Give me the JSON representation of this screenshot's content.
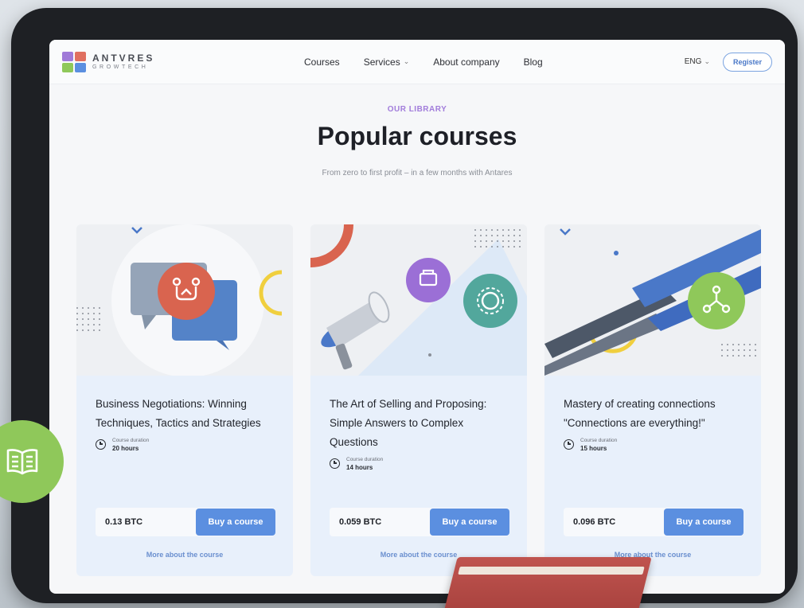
{
  "header": {
    "logo_name": "ANTVRES",
    "logo_sub": "GROWTECH",
    "nav": [
      {
        "label": "Courses",
        "has_dropdown": false
      },
      {
        "label": "Services",
        "has_dropdown": true
      },
      {
        "label": "About company",
        "has_dropdown": false
      },
      {
        "label": "Blog",
        "has_dropdown": false
      }
    ],
    "language": "ENG",
    "register_label": "Register"
  },
  "section": {
    "eyebrow": "OUR LIBRARY",
    "title": "Popular courses",
    "subtitle": "From zero to first profit – in a few months with Antares"
  },
  "courses": [
    {
      "title": "Business Negotiations: Winning Techniques, Tactics and Strategies",
      "duration_label": "Course duration",
      "duration": "20 hours",
      "price": "0.13 BTC",
      "buy_label": "Buy a course",
      "more_label": "More about the course",
      "icon": "negotiation-icon",
      "icon_color": "#d9644f"
    },
    {
      "title": "The Art of Selling and Proposing: Simple Answers to Complex Questions",
      "duration_label": "Course duration",
      "duration": "14 hours",
      "price": "0.059 BTC",
      "buy_label": "Buy a course",
      "more_label": "More about the course",
      "icon": "megaphone-icon",
      "icon_color": "#9b6fd6"
    },
    {
      "title": "Mastery of creating connections \"Connections are everything!\"",
      "duration_label": "Course duration",
      "duration": "15 hours",
      "price": "0.096 BTC",
      "buy_label": "Buy a course",
      "more_label": "More about the course",
      "icon": "network-icon",
      "icon_color": "#8fc85a"
    }
  ],
  "colors": {
    "accent": "#5b8fe0",
    "eyebrow": "#a27ddb",
    "card_bg": "#e8f0fb",
    "green_badge": "#8fc85a"
  }
}
